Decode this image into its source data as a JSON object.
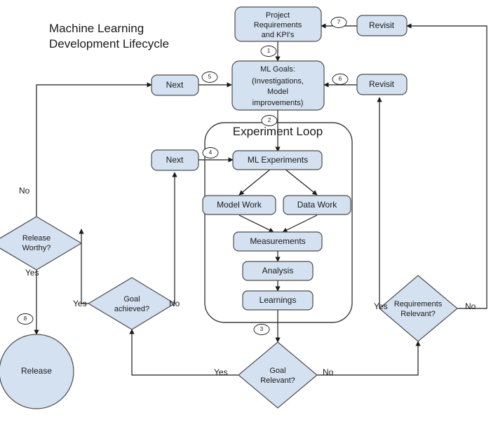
{
  "diagram": {
    "title_line1": "Machine Learning",
    "title_line2": "Development Lifecycle",
    "loop_title": "Experiment Loop",
    "colors": {
      "node_fill": "#d4e1f0",
      "node_stroke": "#4c4c4c",
      "edge": "#1a1a1a",
      "text": "#1a1a1a",
      "background": "#ffffff"
    }
  },
  "nodes": {
    "project_requirements": {
      "line1": "Project",
      "line2": "Requirements",
      "line3": "and KPI's",
      "shape": "rounded-rectangle"
    },
    "ml_goals": {
      "line1": "ML Goals:",
      "line2": "(Investigations,",
      "line3": "Model",
      "line4": "improvements)",
      "shape": "rounded-rectangle"
    },
    "revisit_top": {
      "label": "Revisit",
      "shape": "rounded-rectangle"
    },
    "revisit_mid": {
      "label": "Revisit",
      "shape": "rounded-rectangle"
    },
    "next_goals": {
      "label": "Next",
      "shape": "rounded-rectangle"
    },
    "next_experiments": {
      "label": "Next",
      "shape": "rounded-rectangle"
    },
    "ml_experiments": {
      "label": "ML Experiments",
      "shape": "rounded-rectangle"
    },
    "model_work": {
      "label": "Model Work",
      "shape": "rounded-rectangle"
    },
    "data_work": {
      "label": "Data Work",
      "shape": "rounded-rectangle"
    },
    "measurements": {
      "label": "Measurements",
      "shape": "rounded-rectangle"
    },
    "analysis": {
      "label": "Analysis",
      "shape": "rounded-rectangle"
    },
    "learnings": {
      "label": "Learnings",
      "shape": "rounded-rectangle"
    },
    "release_worthy": {
      "line1": "Release",
      "line2": "Worthy?",
      "shape": "diamond"
    },
    "goal_achieved": {
      "line1": "Goal",
      "line2": "achieved?",
      "shape": "diamond"
    },
    "goal_relevant": {
      "line1": "Goal",
      "line2": "Relevant?",
      "shape": "diamond"
    },
    "requirements_relevant": {
      "line1": "Requirements",
      "line2": "Relevant?",
      "shape": "diamond"
    },
    "release": {
      "label": "Release",
      "shape": "circle"
    }
  },
  "step_markers": {
    "s1": "1",
    "s2": "2",
    "s3": "3",
    "s4": "4",
    "s5": "5",
    "s6": "6",
    "s7": "7",
    "s8": "8"
  },
  "edge_labels": {
    "release_worthy_no": "No",
    "release_worthy_yes": "Yes",
    "goal_achieved_yes": "Yes",
    "goal_achieved_no": "No",
    "goal_relevant_yes": "Yes",
    "goal_relevant_no": "No",
    "requirements_relevant_yes": "Yes",
    "requirements_relevant_no": "No"
  }
}
